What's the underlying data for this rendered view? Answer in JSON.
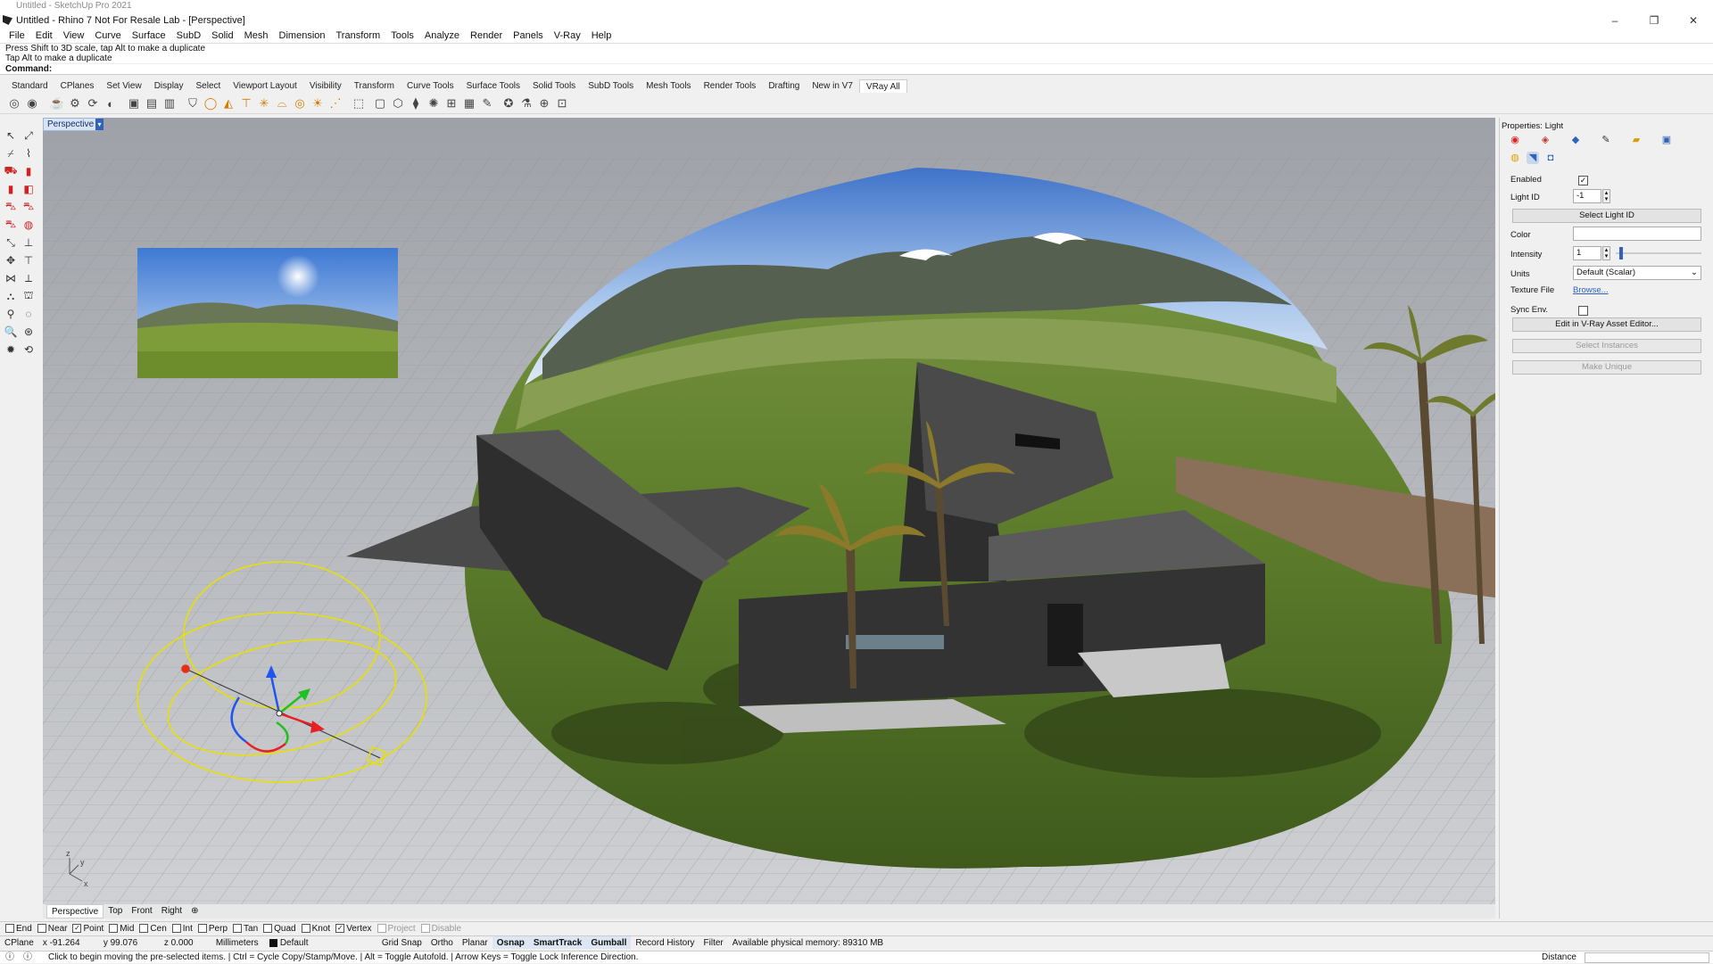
{
  "window": {
    "ghost_title": "Untitled - SketchUp Pro 2021",
    "title": "Untitled - Rhino 7 Not For Resale Lab - [Perspective]",
    "minimize": "–",
    "restore": "❐",
    "close": "✕"
  },
  "menu": [
    "File",
    "Edit",
    "View",
    "Curve",
    "Surface",
    "SubD",
    "Solid",
    "Mesh",
    "Dimension",
    "Transform",
    "Tools",
    "Analyze",
    "Render",
    "Panels",
    "V-Ray",
    "Help"
  ],
  "command_history": [
    "Press Shift to 3D scale, tap Alt to make a duplicate",
    "Tap Alt to make a duplicate"
  ],
  "command_prompt": "Command:",
  "toolbar_tabs": [
    "Standard",
    "CPlanes",
    "Set View",
    "Display",
    "Select",
    "Viewport Layout",
    "Visibility",
    "Transform",
    "Curve Tools",
    "Surface Tools",
    "Solid Tools",
    "SubD Tools",
    "Mesh Tools",
    "Render Tools",
    "Drafting",
    "New in V7",
    "VRay All"
  ],
  "toolbar_tabs_active": "VRay All",
  "viewport": {
    "label": "Perspective",
    "dropdown": "▾",
    "axes": {
      "z": "z",
      "y": "y",
      "x": "x"
    }
  },
  "viewport_tabs": [
    "Perspective",
    "Top",
    "Front",
    "Right",
    "⊕"
  ],
  "properties": {
    "header": "Properties: Light",
    "enabled_label": "Enabled",
    "enabled_checked": "✓",
    "light_id_label": "Light ID",
    "light_id_value": "-1",
    "select_light_id_btn": "Select Light ID",
    "color_label": "Color",
    "intensity_label": "Intensity",
    "intensity_value": "1",
    "units_label": "Units",
    "units_value": "Default (Scalar)",
    "texture_file_label": "Texture File",
    "texture_file_link": "Browse...",
    "sync_env_label": "Sync Env.",
    "edit_asset_btn": "Edit in V-Ray Asset Editor...",
    "select_instances_btn": "Select Instances",
    "make_unique_btn": "Make Unique"
  },
  "osnap": [
    {
      "label": "End",
      "checked": false,
      "dim": false
    },
    {
      "label": "Near",
      "checked": false,
      "dim": false
    },
    {
      "label": "Point",
      "checked": true,
      "dim": false
    },
    {
      "label": "Mid",
      "checked": false,
      "dim": false
    },
    {
      "label": "Cen",
      "checked": false,
      "dim": false
    },
    {
      "label": "Int",
      "checked": false,
      "dim": false
    },
    {
      "label": "Perp",
      "checked": false,
      "dim": false
    },
    {
      "label": "Tan",
      "checked": false,
      "dim": false
    },
    {
      "label": "Quad",
      "checked": false,
      "dim": false
    },
    {
      "label": "Knot",
      "checked": false,
      "dim": false
    },
    {
      "label": "Vertex",
      "checked": true,
      "dim": false
    },
    {
      "label": "Project",
      "checked": false,
      "dim": true
    },
    {
      "label": "Disable",
      "checked": false,
      "dim": true
    }
  ],
  "status": {
    "cplane": "CPlane",
    "x": "x -91.264",
    "y": "y 99.076",
    "z": "z 0.000",
    "units": "Millimeters",
    "layer": "Default",
    "grid_snap": "Grid Snap",
    "ortho": "Ortho",
    "planar": "Planar",
    "osnap": "Osnap",
    "smarttrack": "SmartTrack",
    "gumball": "Gumball",
    "record_history": "Record History",
    "filter": "Filter",
    "memory": "Available physical memory: 89310 MB"
  },
  "prompt_message": "Click to begin moving the pre-selected items. | Ctrl = Cycle Copy/Stamp/Move. | Alt = Toggle Autofold. | Arrow Keys = Toggle Lock Inference Direction.",
  "prompt_right": "Distance",
  "colors": {
    "accent": "#2f62b8",
    "viewport_bg": "#a6a8ad",
    "gizmo_yellow": "#e8e000"
  }
}
